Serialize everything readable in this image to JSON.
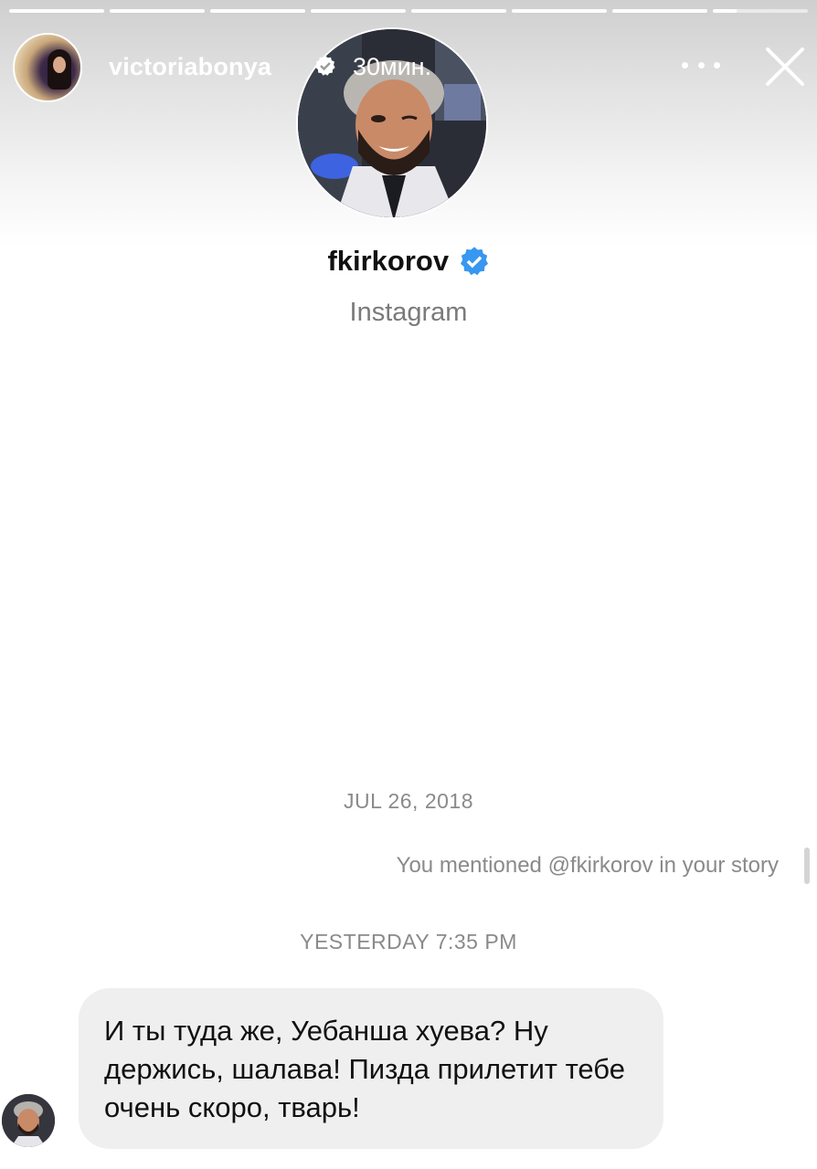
{
  "story": {
    "username": "victoriabonya",
    "time": "30мин.",
    "progress_segments": 8,
    "current_segment_fill": 0.25
  },
  "profile": {
    "username": "fkirkorov",
    "subtitle": "Instagram"
  },
  "conversation": {
    "date_1": "JUL 26, 2018",
    "mention_note": "You mentioned @fkirkorov in your story",
    "date_2": "YESTERDAY 7:35 PM",
    "message": "И ты туда же, Уебанша хуева?  Ну держись, шалава! Пизда прилетит тебе очень скоро, тварь!"
  },
  "colors": {
    "verified": "#3897f0",
    "bubble": "#efefef",
    "meta_text": "#8a8a8a"
  },
  "icons": [
    "verified-badge-icon",
    "more-icon",
    "close-icon"
  ]
}
